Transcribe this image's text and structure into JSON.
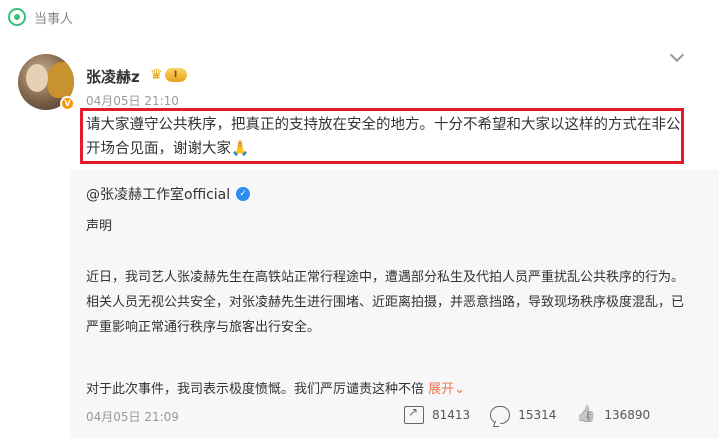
{
  "topbar": {
    "label": "当事人",
    "icon": "location-pin-icon",
    "accent": "#36c07a"
  },
  "post": {
    "username": "张凌赫z",
    "level_badge": "I",
    "verified_badge": "V",
    "date": "04月05日 21:10",
    "text_main": "请大家遵守公共秩序，把真正的支持放在安全的地方。十分不希望和大家以这样的方式在非公开场合见面，谢谢大家",
    "text_emoji": "🙏",
    "highlight_color": "#e31b2b"
  },
  "repost": {
    "author": "@张凌赫工作室official",
    "verified_badge": "✓",
    "heading": "声明",
    "body": "近日，我司艺人张凌赫先生在高铁站正常行程途中，遭遇部分私生及代拍人员严重扰乱公共秩序的行为。相关人员无视公共安全，对张凌赫先生进行围堵、近距离拍摄，并恶意挡路，导致现场秩序极度混乱，已严重影响正常通行秩序与旅客出行安全。",
    "last_line": "对于此次事件，我司表示极度愤慨。我们严厉谴责这种不倍",
    "expand_label": "展开",
    "expand_arrow": "⌄",
    "date": "04月05日 21:09",
    "stats": {
      "reposts": "81413",
      "comments": "15314",
      "likes": "136890"
    }
  }
}
